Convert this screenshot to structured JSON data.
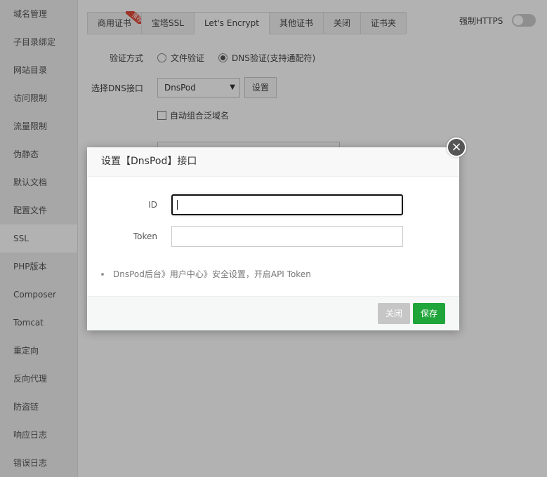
{
  "sidebar": {
    "items": [
      "域名管理",
      "子目录绑定",
      "网站目录",
      "访问限制",
      "流量限制",
      "伪静态",
      "默认文档",
      "配置文件",
      "SSL",
      "PHP版本",
      "Composer",
      "Tomcat",
      "重定向",
      "反向代理",
      "防盗链",
      "响应日志",
      "错误日志"
    ],
    "active": "SSL"
  },
  "tabs": [
    "商用证书",
    "宝塔SSL",
    "Let's Encrypt",
    "其他证书",
    "关闭",
    "证书夹"
  ],
  "tab_ribbon": "推荐",
  "https_label": "强制HTTPS",
  "verify": {
    "label": "验证方式",
    "option_file": "文件验证",
    "option_dns": "DNS验证(支持通配符)"
  },
  "dns": {
    "label": "选择DNS接口",
    "selected": "DnsPod",
    "setting_button": "设置"
  },
  "auto_wildcard_label": "自动组合泛域名",
  "dialog": {
    "title": "设置【DnsPod】接口",
    "close_glyph": "×",
    "fields": {
      "id_label": "ID",
      "id_value": "",
      "token_label": "Token",
      "token_value": ""
    },
    "tip": "DnsPod后台》用户中心》安全设置，开启API Token",
    "buttons": {
      "close": "关闭",
      "save": "保存"
    }
  },
  "colors": {
    "save_green": "#20a53a",
    "close_gray": "#c6c6c6",
    "ribbon_red": "#e14a3c"
  }
}
